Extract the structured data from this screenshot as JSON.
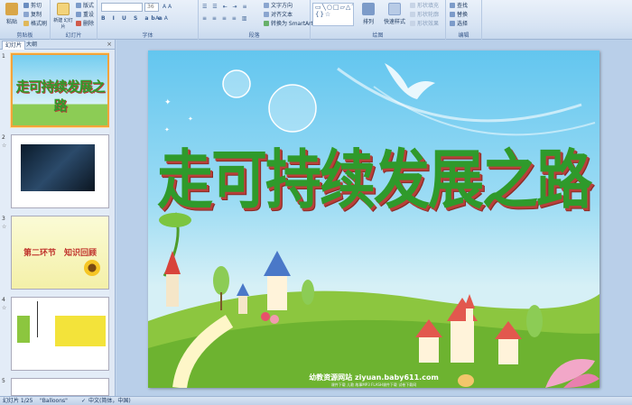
{
  "ribbon": {
    "clipboard": {
      "label": "剪贴板",
      "paste": "粘贴",
      "cut": "剪切",
      "copy": "复制",
      "format_painter": "格式刷"
    },
    "slides": {
      "label": "幻灯片",
      "new_slide": "新建\n幻灯片",
      "layout": "版式",
      "reset": "重设",
      "delete": "删除"
    },
    "font": {
      "label": "字体",
      "size": "36"
    },
    "paragraph": {
      "label": "段落",
      "text_direction": "文字方向",
      "align_text": "对齐文本",
      "smartart": "转换为 SmartArt"
    },
    "drawing": {
      "label": "绘图",
      "arrange": "排列",
      "quick_styles": "快速样式",
      "shape_fill": "形状填充",
      "shape_outline": "形状轮廓",
      "shape_effects": "形状效果"
    },
    "editing": {
      "label": "编辑",
      "find": "查找",
      "replace": "替换",
      "select": "选择"
    }
  },
  "left_panel": {
    "tabs": [
      "幻灯片",
      "大纲"
    ],
    "close": "×",
    "thumbs": [
      {
        "num": "1",
        "title": "走可持续发展之路"
      },
      {
        "num": "2"
      },
      {
        "num": "3",
        "title": "第二环节　知识回顾"
      },
      {
        "num": "4"
      },
      {
        "num": "5"
      }
    ]
  },
  "slide": {
    "title": "走可持续发展之路",
    "footer": "幼教资源网站  ziyuan.baby611.com",
    "footer_sub": "课件下载  儿歌  故事MP3  FLASH课件下载  试卷下载网"
  },
  "status": {
    "slide_info": "幻灯片 1/25",
    "theme": "\"Balloons\"",
    "language": "中文(简体，中国)"
  },
  "colors": {
    "title_green": "#2f9a2b",
    "title_shadow": "#b8403a",
    "selection": "#f3a33a"
  }
}
